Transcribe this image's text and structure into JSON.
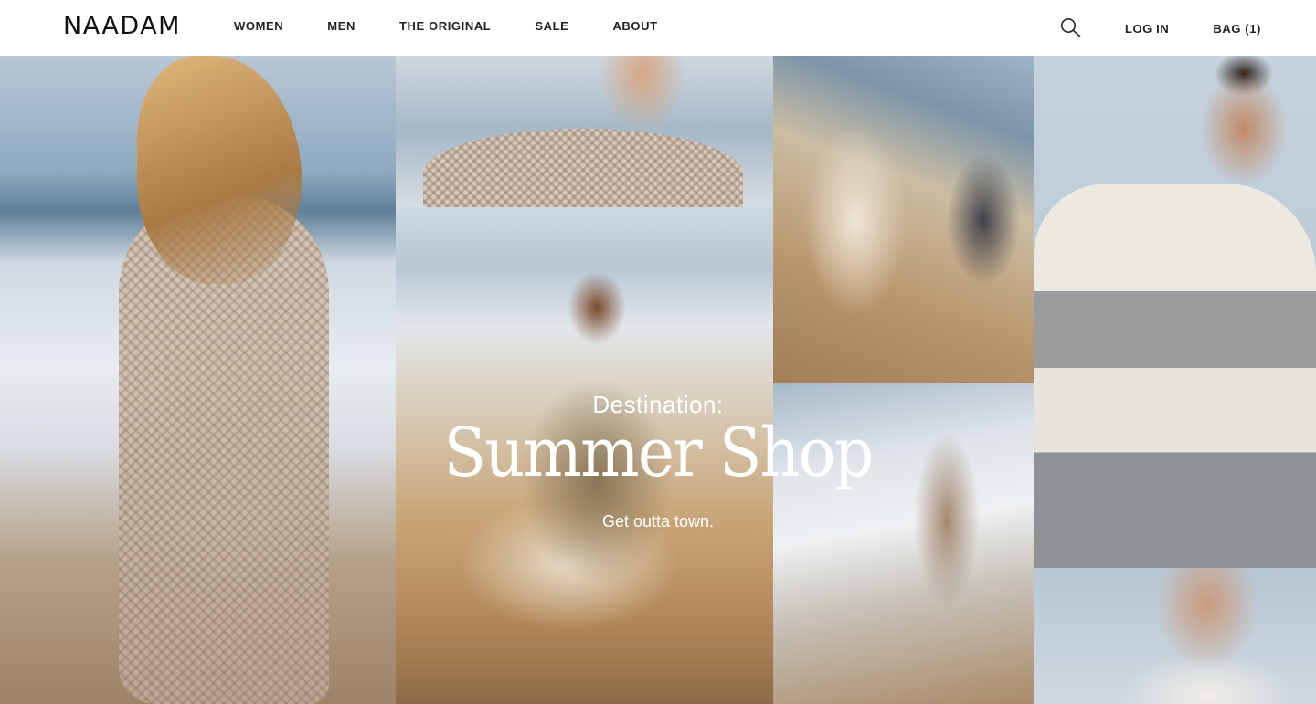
{
  "header": {
    "logo": "NAADAM",
    "nav": [
      "WOMEN",
      "MEN",
      "THE ORIGINAL",
      "SALE",
      "ABOUT"
    ],
    "search_icon": "search-icon",
    "login_label": "LOG IN",
    "bag_label": "BAG (1)"
  },
  "hero": {
    "eyebrow": "Destination:",
    "headline": "Summer Shop",
    "tagline": "Get outta town."
  },
  "colors": {
    "text": "#222222",
    "hero_text": "#ffffff",
    "background": "#ffffff"
  }
}
